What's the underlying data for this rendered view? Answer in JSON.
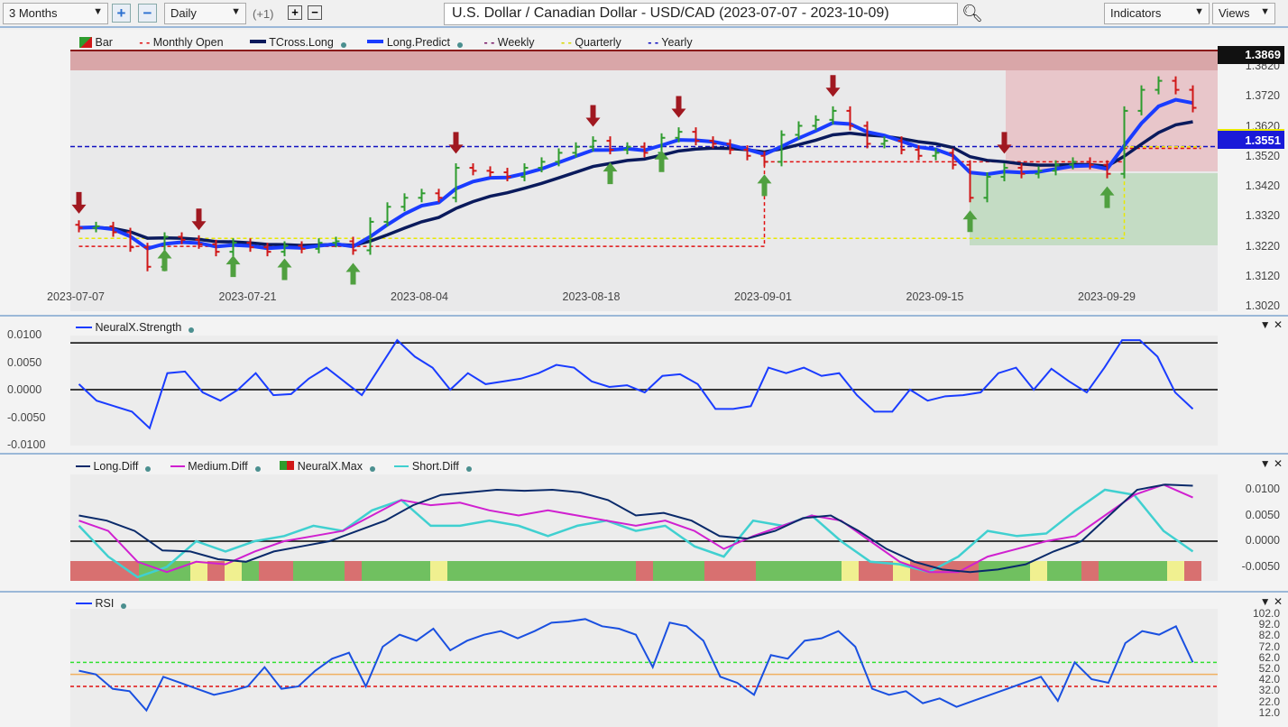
{
  "toolbar": {
    "range": "3 Months",
    "interval": "Daily",
    "offset": "(+1)",
    "title": "U.S. Dollar / Canadian Dollar - USD/CAD (2023-07-07 - 2023-10-09)",
    "indicators": "Indicators",
    "views": "Views"
  },
  "main": {
    "legend": [
      "Bar",
      "Monthly Open",
      "TCross.Long",
      "Long.Predict",
      "Weekly",
      "Quarterly",
      "Yearly"
    ],
    "colors": {
      "up": "#2e9c2e",
      "down": "#d01818",
      "long_predict": "#1a3cff",
      "tcross": "#0a1a5c",
      "monthly": "#e01010",
      "weekly": "#7a1a6a",
      "quarterly": "#e8e800",
      "yearly": "#1010c0"
    },
    "price_ticks": [
      "1.3820",
      "1.3720",
      "1.3620",
      "1.3520",
      "1.3420",
      "1.3320",
      "1.3220",
      "1.3120",
      "1.3020"
    ],
    "last_price": "1.3869",
    "yearly_label": "1.3551",
    "date_ticks": [
      "2023-07-07",
      "2023-07-21",
      "2023-08-04",
      "2023-08-18",
      "2023-09-01",
      "2023-09-15",
      "2023-09-29"
    ]
  },
  "chart_data": [
    {
      "type": "candlestick",
      "ylim": [
        1.3,
        1.388
      ],
      "x_ticks": [
        "2023-07-07",
        "2023-07-21",
        "2023-08-04",
        "2023-08-18",
        "2023-09-01",
        "2023-09-15",
        "2023-09-29"
      ],
      "close": [
        1.328,
        1.3285,
        1.3265,
        1.3215,
        1.315,
        1.325,
        1.324,
        1.3225,
        1.32,
        1.323,
        1.3215,
        1.32,
        1.322,
        1.321,
        1.323,
        1.3235,
        1.3205,
        1.33,
        1.335,
        1.338,
        1.3395,
        1.338,
        1.348,
        1.347,
        1.3465,
        1.345,
        1.348,
        1.35,
        1.353,
        1.355,
        1.357,
        1.354,
        1.355,
        1.353,
        1.358,
        1.36,
        1.357,
        1.356,
        1.354,
        1.352,
        1.35,
        1.359,
        1.362,
        1.364,
        1.367,
        1.362,
        1.356,
        1.357,
        1.354,
        1.352,
        1.353,
        1.349,
        1.338,
        1.345,
        1.348,
        1.346,
        1.347,
        1.349,
        1.35,
        1.349,
        1.346,
        1.367,
        1.374,
        1.377,
        1.374,
        1.368
      ],
      "yearly": 1.3551,
      "monthly_open": [
        {
          "from": 0,
          "value": 1.3218
        },
        {
          "from": 40,
          "value": 1.35
        },
        {
          "from": 61,
          "value": 1.3545
        }
      ],
      "quarterly": [
        {
          "from": 0,
          "value": 1.3245
        },
        {
          "from": 61,
          "value": 1.355
        }
      ],
      "sell_signals": [
        0,
        7,
        22,
        30,
        35,
        44,
        54
      ],
      "buy_signals": [
        5,
        9,
        12,
        16,
        31,
        34,
        40,
        52,
        60
      ]
    },
    {
      "type": "line",
      "name": "NeuralX.Strength",
      "ylim": [
        -0.012,
        0.012
      ],
      "y_ticks": [
        "0.0100",
        "0.0050",
        "0.0000",
        "-0.0050",
        "-0.0100"
      ],
      "upper_line": 0.0085,
      "values": [
        0.001,
        -0.002,
        -0.003,
        -0.004,
        -0.007,
        0.003,
        0.0033,
        -0.0005,
        -0.002,
        0,
        0.003,
        -0.001,
        -0.0008,
        0.002,
        0.004,
        0.0015,
        -0.001,
        0.004,
        0.009,
        0.006,
        0.004,
        0,
        0.003,
        0.001,
        0.0015,
        0.002,
        0.003,
        0.0045,
        0.004,
        0.0015,
        0.0005,
        0.0008,
        -0.0005,
        0.0025,
        0.0028,
        0.001,
        -0.0035,
        -0.0035,
        -0.003,
        0.004,
        0.003,
        0.004,
        0.0025,
        0.003,
        -0.001,
        -0.004,
        -0.004,
        0,
        -0.002,
        -0.0012,
        -0.001,
        -0.0005,
        0.003,
        0.004,
        0,
        0.0038,
        0.0015,
        -0.0005,
        0.004,
        0.009,
        0.009,
        0.006,
        -0.0005,
        -0.0035
      ]
    },
    {
      "type": "line",
      "ylim": [
        -0.0075,
        0.0125
      ],
      "y_ticks": [
        "0.0100",
        "0.0050",
        "0.0000",
        "-0.0050"
      ],
      "series": [
        {
          "name": "Long.Diff",
          "color": "#0a2a6a",
          "values": [
            0.005,
            0.004,
            0.002,
            -0.0018,
            -0.002,
            -0.0035,
            -0.004,
            -0.002,
            -0.001,
            0,
            0.002,
            0.004,
            0.007,
            0.009,
            0.0095,
            0.01,
            0.0098,
            0.01,
            0.0095,
            0.008,
            0.005,
            0.0055,
            0.004,
            0.001,
            0.0005,
            0.002,
            0.0045,
            0.005,
            0.002,
            -0.0015,
            -0.004,
            -0.0055,
            -0.006,
            -0.0055,
            -0.0045,
            -0.002,
            0,
            0.005,
            0.01,
            0.011,
            0.0108
          ]
        },
        {
          "name": "Medium.Diff",
          "color": "#d020d0",
          "values": [
            0.004,
            0.002,
            -0.004,
            -0.006,
            -0.004,
            -0.0045,
            -0.002,
            0,
            0.001,
            0.002,
            0.005,
            0.008,
            0.007,
            0.0075,
            0.006,
            0.005,
            0.006,
            0.005,
            0.004,
            0.003,
            0.004,
            0.002,
            -0.0015,
            0.001,
            0.003,
            0.005,
            0.004,
            0,
            -0.004,
            -0.006,
            -0.006,
            -0.003,
            -0.0015,
            0,
            0.001,
            0.005,
            0.009,
            0.011,
            0.0085
          ]
        },
        {
          "name": "NeuralX.Max",
          "color": "#2e9c2e"
        },
        {
          "name": "Short.Diff",
          "color": "#40d0d0",
          "values": [
            0.003,
            -0.003,
            -0.007,
            -0.005,
            0,
            -0.002,
            0,
            0.001,
            0.003,
            0.002,
            0.006,
            0.008,
            0.003,
            0.003,
            0.004,
            0.003,
            0.001,
            0.003,
            0.004,
            0.002,
            0.003,
            -0.001,
            -0.003,
            0.004,
            0.003,
            0.005,
            0,
            -0.004,
            -0.0045,
            -0.006,
            -0.003,
            0.002,
            0.001,
            0.0015,
            0.006,
            0.01,
            0.009,
            0.002,
            -0.002
          ]
        }
      ],
      "neuralx_max_strip": [
        [
          "red",
          4
        ],
        [
          "green",
          3
        ],
        [
          "yellow",
          1
        ],
        [
          "red",
          1
        ],
        [
          "yellow",
          1
        ],
        [
          "green",
          1
        ],
        [
          "red",
          2
        ],
        [
          "green",
          3
        ],
        [
          "red",
          1
        ],
        [
          "green",
          4
        ],
        [
          "yellow",
          1
        ],
        [
          "green",
          11
        ],
        [
          "red",
          1
        ],
        [
          "green",
          3
        ],
        [
          "red",
          3
        ],
        [
          "green",
          5
        ],
        [
          "yellow",
          1
        ],
        [
          "red",
          2
        ],
        [
          "yellow",
          1
        ],
        [
          "red",
          4
        ],
        [
          "green",
          3
        ],
        [
          "yellow",
          1
        ],
        [
          "green",
          2
        ],
        [
          "red",
          1
        ],
        [
          "green",
          4
        ],
        [
          "yellow",
          1
        ],
        [
          "red",
          1
        ]
      ]
    },
    {
      "type": "line",
      "name": "RSI",
      "ylim": [
        12,
        102
      ],
      "y_ticks": [
        "102.0",
        "92.0",
        "82.0",
        "72.0",
        "62.0",
        "52.0",
        "42.0",
        "32.0",
        "22.0",
        "12.0"
      ],
      "levels": [
        62,
        52,
        42
      ],
      "values": [
        55,
        52,
        40,
        38,
        22,
        50,
        45,
        40,
        35,
        38,
        42,
        58,
        40,
        42,
        55,
        65,
        70,
        42,
        75,
        85,
        80,
        90,
        72,
        80,
        85,
        88,
        82,
        88,
        95,
        96,
        98,
        92,
        90,
        85,
        58,
        95,
        92,
        80,
        50,
        45,
        35,
        68,
        65,
        80,
        82,
        88,
        75,
        40,
        35,
        38,
        28,
        32,
        25,
        30,
        35,
        40,
        45,
        50,
        30,
        62,
        48,
        45,
        78,
        88,
        85,
        92,
        62
      ]
    }
  ]
}
